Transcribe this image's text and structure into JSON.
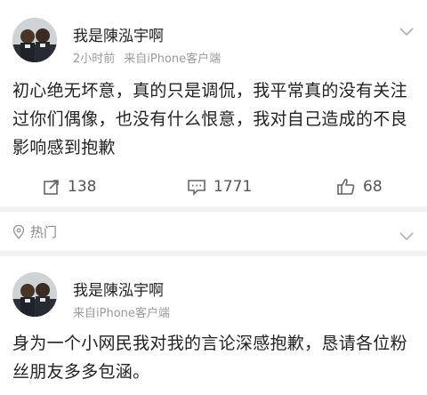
{
  "post1": {
    "username": "我是陳泓宇啊",
    "time": "2小时前",
    "source": "来自iPhone客户端",
    "content": "初心绝无坏意，真的只是调侃，我平常真的没有关注过你们偶像，也没有什么恨意，我对自己造成的不良影响感到抱歉",
    "repost_count": "138",
    "comment_count": "1771",
    "like_count": "68"
  },
  "hot_section": {
    "label": "热门"
  },
  "post2": {
    "username": "我是陳泓宇啊",
    "source": "来自iPhone客户端",
    "content": "身为一个小网民我对我的言论深感抱歉，恳请各位粉丝朋友多多包涵。"
  },
  "icons": {
    "repost": "repost-icon",
    "comment": "comment-icon",
    "like": "thumbs-up-icon",
    "menu": "chevron-down-icon",
    "hot": "location-pin-icon"
  },
  "colors": {
    "meta_text": "#9a9a9a",
    "separator": "#f2f2f2",
    "body_text": "#222222"
  }
}
